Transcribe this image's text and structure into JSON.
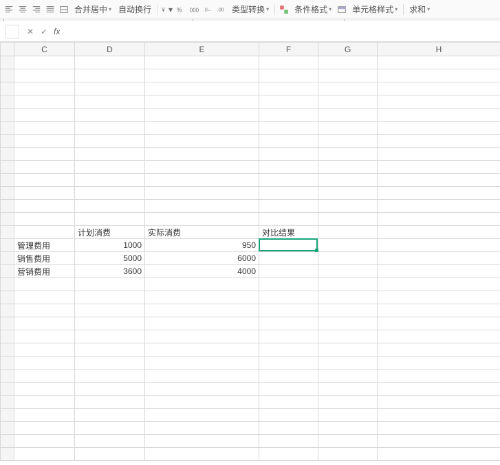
{
  "toolbar": {
    "merge_label": "合并居中",
    "wrap_label": "自动换行",
    "type_convert_label": "类型转换",
    "cond_format_label": "条件格式",
    "cell_style_label": "单元格样式",
    "sum_label": "求和"
  },
  "formula_bar": {
    "value": ""
  },
  "columns": [
    "C",
    "D",
    "E",
    "F",
    "G",
    "H"
  ],
  "selected_column": "F",
  "active_cell": "F15",
  "rows": [
    {},
    {},
    {},
    {},
    {},
    {},
    {},
    {},
    {},
    {},
    {},
    {},
    {},
    {
      "D": {
        "v": "计划消费",
        "t": "txt"
      },
      "E": {
        "v": "实际消费",
        "t": "txt"
      },
      "F": {
        "v": "对比结果",
        "t": "txt"
      }
    },
    {
      "C": {
        "v": "管理费用",
        "t": "txt"
      },
      "D": {
        "v": "1000",
        "t": "num"
      },
      "E": {
        "v": "950",
        "t": "num"
      }
    },
    {
      "C": {
        "v": "销售费用",
        "t": "txt"
      },
      "D": {
        "v": "5000",
        "t": "num"
      },
      "E": {
        "v": "6000",
        "t": "num"
      }
    },
    {
      "C": {
        "v": "营销费用",
        "t": "txt"
      },
      "D": {
        "v": "3600",
        "t": "num"
      },
      "E": {
        "v": "4000",
        "t": "num"
      }
    },
    {},
    {},
    {},
    {},
    {},
    {},
    {},
    {},
    {},
    {},
    {},
    {},
    {},
    {}
  ]
}
